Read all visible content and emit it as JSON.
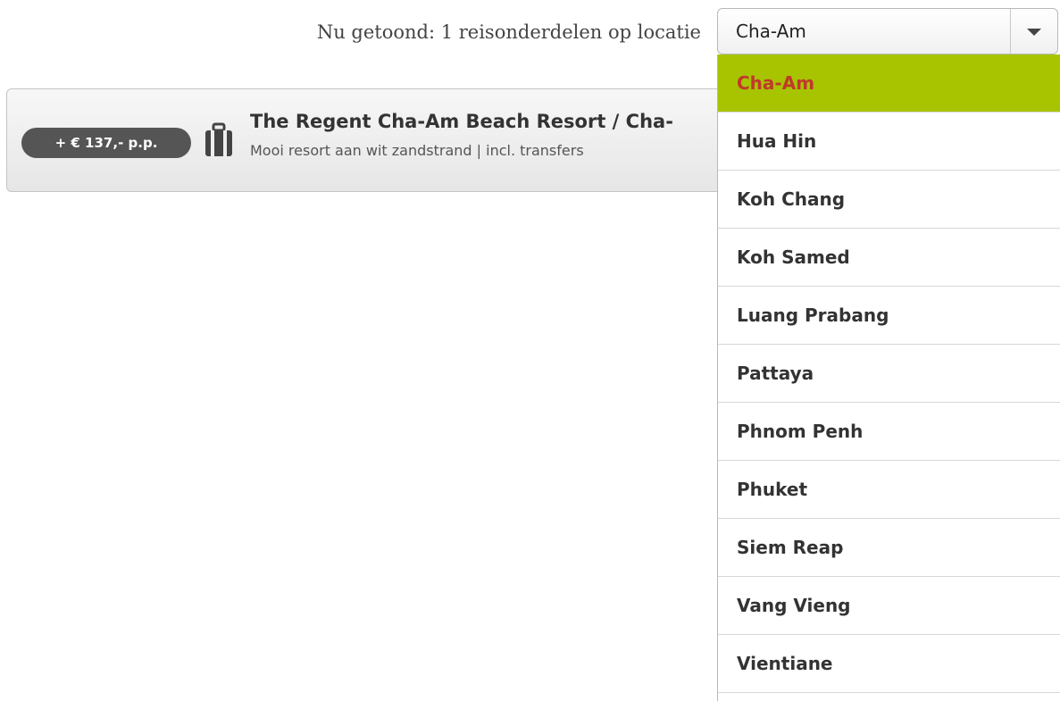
{
  "filter": {
    "label": "Nu getoond: 1 reisonderdelen op locatie",
    "selected": "Cha-Am"
  },
  "result": {
    "price": "+ € 137,- p.p.",
    "icon": "suitcase-icon",
    "title": "The Regent Cha-Am Beach Resort / Cha-",
    "subtitle": "Mooi resort aan wit zandstrand | incl. transfers"
  },
  "dropdown": {
    "options": [
      {
        "label": "Cha-Am",
        "selected": true
      },
      {
        "label": "Hua Hin"
      },
      {
        "label": "Koh Chang"
      },
      {
        "label": "Koh Samed"
      },
      {
        "label": "Luang Prabang"
      },
      {
        "label": "Pattaya"
      },
      {
        "label": "Phnom Penh"
      },
      {
        "label": "Phuket"
      },
      {
        "label": "Siem Reap"
      },
      {
        "label": "Vang Vieng"
      },
      {
        "label": "Vientiane"
      }
    ]
  },
  "colors": {
    "selected_background": "#a8c400",
    "selected_text": "#c0392b",
    "badge_background": "#555555"
  }
}
